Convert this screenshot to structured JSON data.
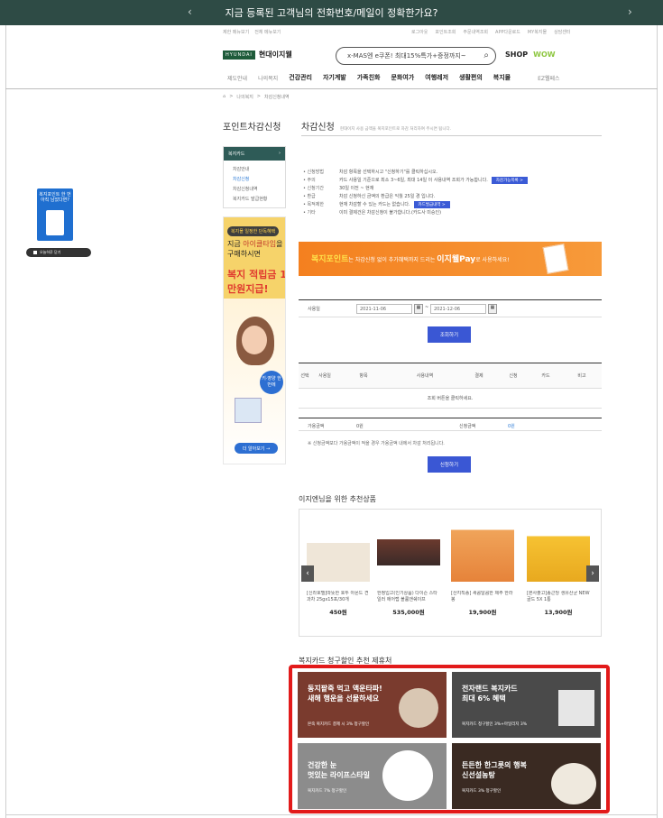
{
  "top_banner": {
    "text": "지금 등록된 고객님의 전화번호/메일이 정확한가요?",
    "prev": "‹",
    "next": "›"
  },
  "utility": {
    "left": [
      "제한 메뉴보기",
      "전체 메뉴보기"
    ],
    "right": [
      "로그아웃",
      "포인트조회",
      "주문내역조회",
      "APP다운로드",
      "MY복지몰",
      "상담센터"
    ]
  },
  "logo": {
    "brand": "HYUNDAI",
    "name": "현대이지웰"
  },
  "search": {
    "placeholder": "x-MAS엔 e쿠폰! 최대15%특가+증정까지~"
  },
  "shop_links": {
    "shop": "SHOP",
    "wow": "WOW"
  },
  "gnb": {
    "items": [
      "제도안내",
      "나의복지",
      "건강관리",
      "자기계발",
      "가족친화",
      "문화여가",
      "여행레저",
      "생활편의",
      "복지몰"
    ],
    "extra": "EZ웰페스"
  },
  "breadcrumb": [
    "나의복지",
    "차감신청내역"
  ],
  "sidebar": {
    "title": "포인트차감신청",
    "head": "복지카드",
    "items": [
      "차감안내",
      "차감신청",
      "차감신청내역",
      "복지카드 발급현황"
    ],
    "active_index": 1
  },
  "side_banner": {
    "badge": "복지몰 일정한 단독혜택",
    "line1_prefix": "지금 ",
    "line1_highlight": "아이클타임",
    "line1_suffix": "을 구매하시면",
    "line2": "복지 적립금 1만원지급!",
    "circle": "키·영양 한번에",
    "more": "더 알아보기 →"
  },
  "float_widget": {
    "title": "복지포인트 한 번 아직 남았다면?",
    "label": "오늘하루 닫기"
  },
  "main": {
    "title": "차감신청",
    "desc": "현대이지 사용 금액을 복지포인트로 차감 처리하여 주시면 됩니다.",
    "info": [
      {
        "k": "신청방법",
        "v": "차감 항목을 선택하시고 \"신청하기\"를 클릭하십시오."
      },
      {
        "k": "주의",
        "v": "카드 사용일 기준으로 최소 3~6일, 최대 14일 이 사용내역 조회가 가능합니다.",
        "chip": "차감가능목록 >"
      },
      {
        "k": "신청기간",
        "v": "30일 이전 ~ 현재"
      },
      {
        "k": "환급",
        "v": "차감 신청하신 금액의 환급은 익월 25일 경 입니다."
      },
      {
        "k": "목적제한",
        "v": "현재 차감할 수 있는 카드는 없습니다.",
        "chip": "카드발급내역 >"
      },
      {
        "k": "기타",
        "v": "이미 결제건은 차감신청이 불가합니다.(카드사 미승인)"
      }
    ]
  },
  "promo": {
    "prefix": "복지포인트",
    "mid": "는 차감신청 없이 추가혜택까지 드리는 ",
    "highlight": "이지웰Pay",
    "suffix": "로 사용하세요!"
  },
  "date_search": {
    "label": "사용일",
    "from": "2021-11-06",
    "to": "2021-12-06",
    "cal": "▦",
    "tilde": "~",
    "button": "조회하기"
  },
  "table": {
    "headers": [
      "선택",
      "사용일",
      "항목",
      "사용내역",
      "결제",
      "신청",
      "카드",
      "비고"
    ],
    "empty": "조회 버튼을 클릭하세요."
  },
  "summary": {
    "label1": "가용금액",
    "value1": "0원",
    "label2": "신청금액",
    "value2": "0원"
  },
  "note": "※ 신청금액보다 가용금액이 적을 경우 가용금액 내에서 차감 처리됩니다.",
  "apply_button": "신청하기",
  "recommend": {
    "title": "이지엔님을 위한 추천상품",
    "prev": "‹",
    "next": "›",
    "products": [
      {
        "name": "[신라호텔]따뜻한 호두 아몬드 견과차 25gx15포/30개",
        "price": "450원"
      },
      {
        "name": "한정입고(인기상품) 다이슨 스타일러 에어랩 볼륨앤쉐이프",
        "price": "535,000원"
      },
      {
        "name": "[산지직송] 새콤달콤한 제주 한라봉",
        "price": "19,900원"
      },
      {
        "name": "[본사출고]종근당 생유산균 NEW골드 5X 1통",
        "price": "13,900원"
      }
    ]
  },
  "stores": {
    "title": "복지카드 청구할인 추천 제휴처",
    "items": [
      {
        "title1": "동지팥죽 먹고 액운타파!",
        "title2": "새해 행운을 선물하세요",
        "sub": "본죽 복지카드 결제 시 3% 청구할인",
        "color": "#7a3b2e"
      },
      {
        "title1": "전자랜드 복지카드",
        "title2": "최대 6% 혜택",
        "sub": "복지카드 청구할인 3%+마일리지 3%",
        "color": "#4a4a4a"
      },
      {
        "title1": "건강한 눈",
        "title2": "멋있는 라이프스타일",
        "sub": "복지카드 7% 청구할인",
        "color": "#8c8c8c"
      },
      {
        "title1": "든든한 한그릇의 행복",
        "title2": "신선설농탕",
        "sub": "복지카드 3% 청구할인",
        "color": "#3a2a22"
      }
    ]
  }
}
